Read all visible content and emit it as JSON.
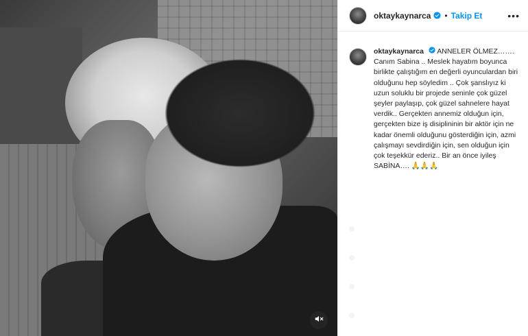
{
  "post": {
    "username": "oktaykaynarca",
    "separator": "•",
    "follow_label": "Takip Et",
    "more_label": "•••",
    "caption_user": "oktaykaynarca",
    "caption_text": "ANNELER ÖLMEZ……. Canım Sabina .. Meslek hayatım boyunca birlikte çalıştığım en değerli oyunculardan biri olduğunu hep söyledim .. Çok şanslıyız ki uzun soluklu bir projede seninle çok güzel şeyler paylaşıp, çok güzel sahnelere hayat verdik.. Gerçekten annemiz olduğun için, gerçekten bize iş disiplininin bir aktör için ne kadar önemli olduğunu gösterdiğin için, azmi çalışmayı sevdirdiğin için, sen olduğun için çok teşekkür ederiz.. Bir an önce iyileş SABİNA…. 🙏🙏🙏"
  },
  "icons": {
    "verified": "verified-badge-icon",
    "mute": "muted-speaker-icon",
    "more": "more-options-icon"
  },
  "colors": {
    "accent": "#0095f6",
    "text": "#262626",
    "border": "#efefef"
  }
}
